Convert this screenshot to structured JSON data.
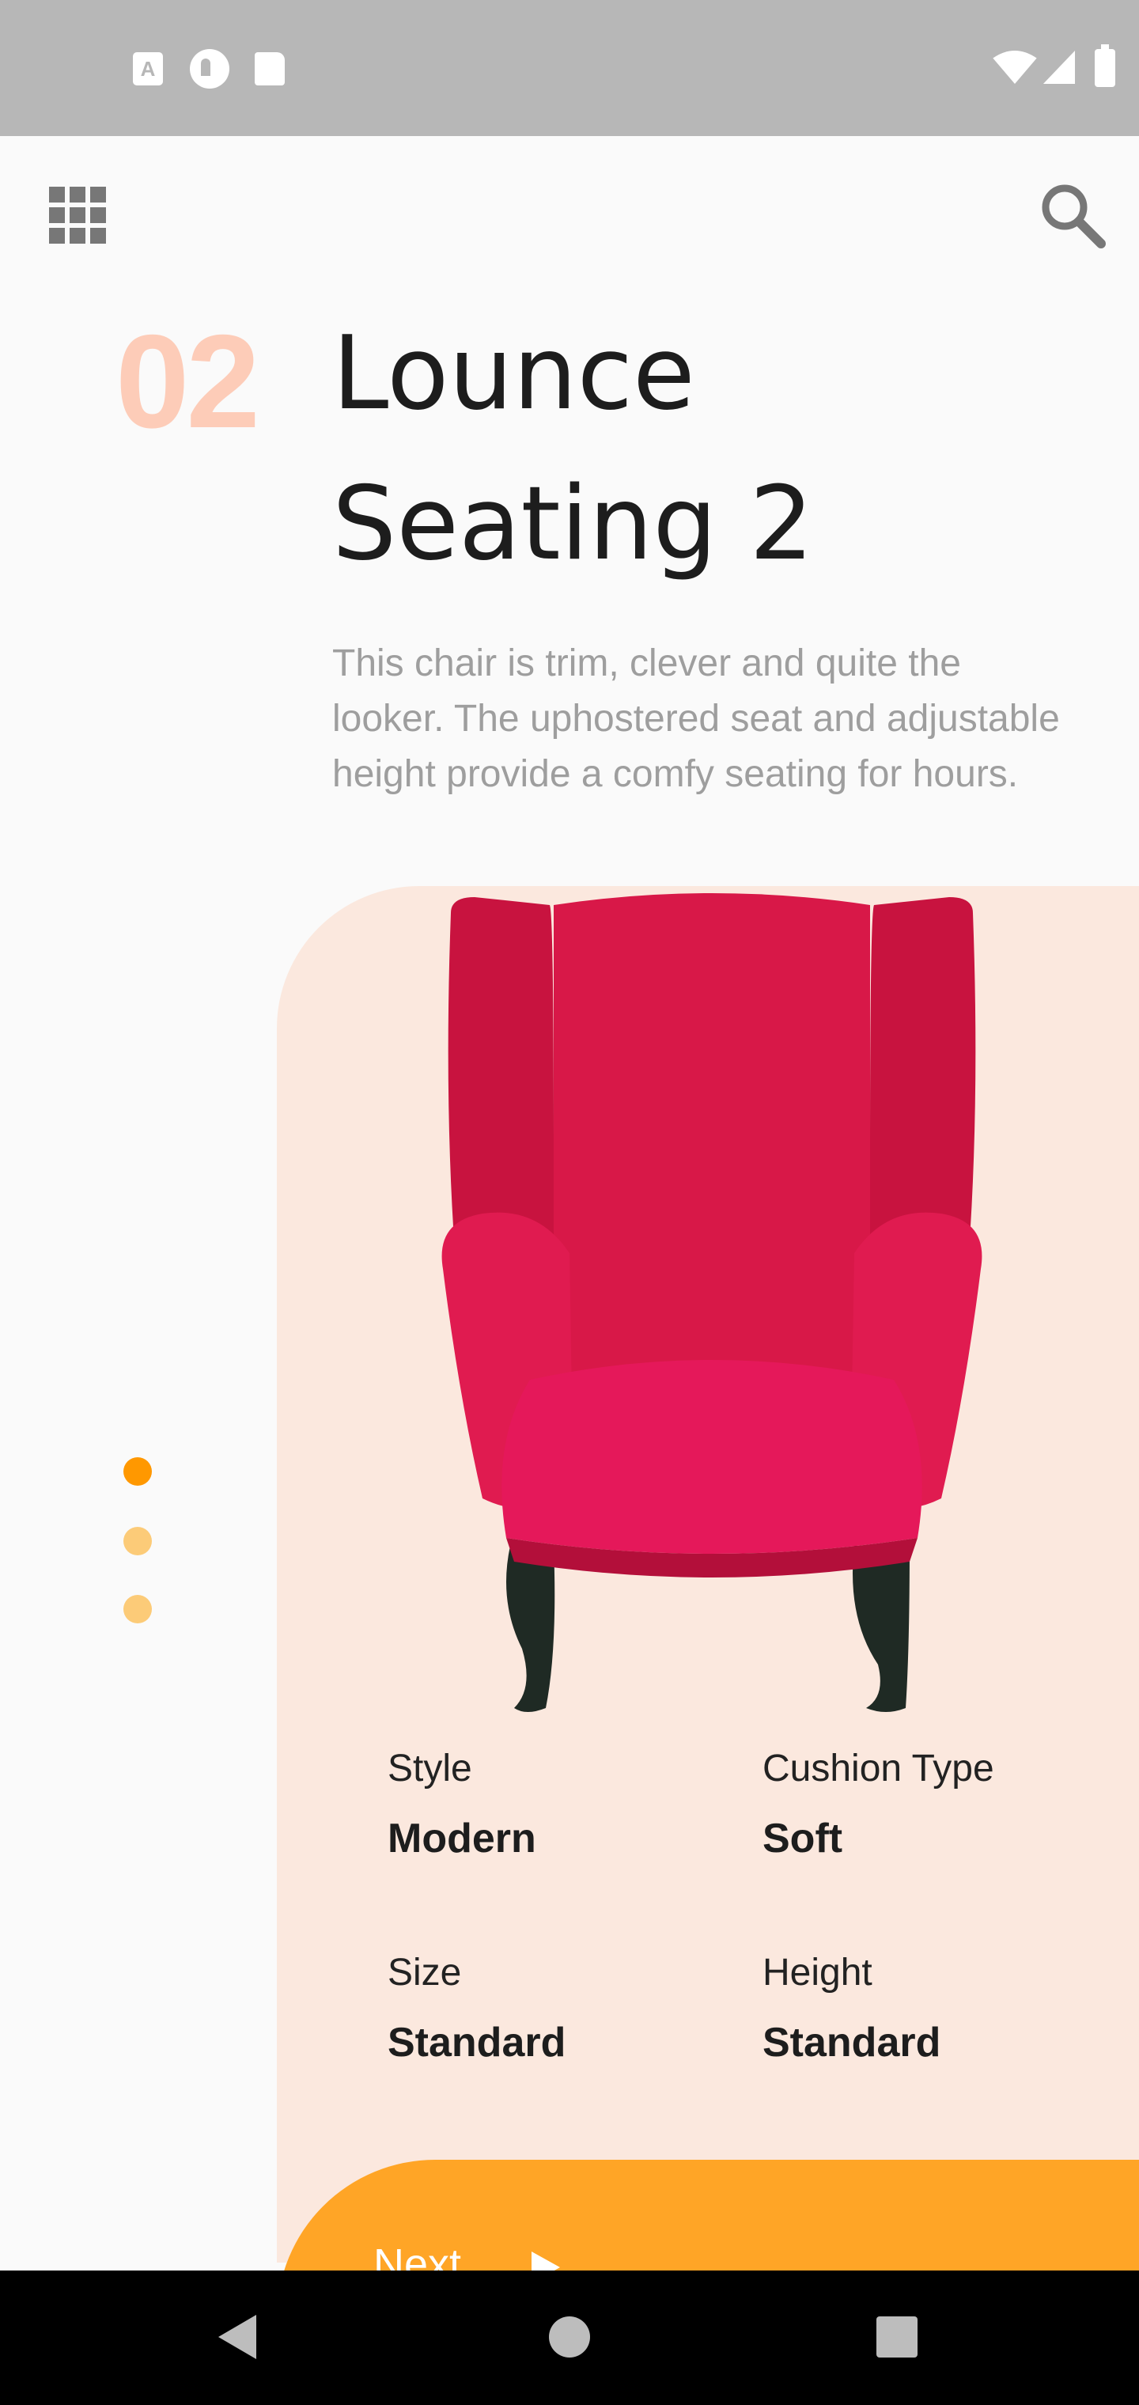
{
  "status_bar": {
    "icons": [
      "text-a-icon",
      "p-circle-icon",
      "sd-card-icon",
      "wifi-icon",
      "signal-icon",
      "battery-icon"
    ],
    "a_glyph": "A"
  },
  "top_bar": {
    "menu_icon": "grid-menu-icon",
    "search_icon": "search-icon"
  },
  "product": {
    "number": "02",
    "title_line1": "Lounce",
    "title_line2": "Seating 2",
    "description": "This chair is trim, clever and quite the looker. The uphostered seat and adjustable height provide a comfy seating for hours.",
    "image": "red-wingback-chair"
  },
  "specs": [
    {
      "label": "Style",
      "value": "Modern"
    },
    {
      "label": "Cushion Type",
      "value": "Soft"
    },
    {
      "label": "Size",
      "value": "Standard"
    },
    {
      "label": "Height",
      "value": "Standard"
    }
  ],
  "pager": {
    "count": 3,
    "active_index": 0
  },
  "next_button": {
    "label": "Next",
    "icon": "play-arrow-icon"
  },
  "nav_bar": {
    "icons": [
      "back-icon",
      "home-icon",
      "recents-icon"
    ]
  },
  "colors": {
    "accent": "#ff9800",
    "button": "#ffa526",
    "card": "#fbe8de",
    "number": "#fdccb8",
    "chair": "#d81848"
  }
}
